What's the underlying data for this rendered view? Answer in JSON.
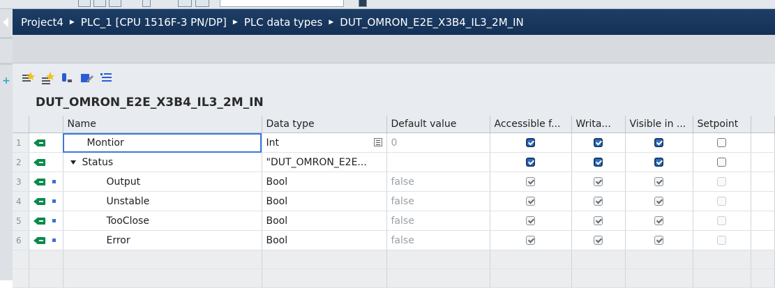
{
  "breadcrumb": [
    "Project4",
    "PLC_1 [CPU 1516F-3 PN/DP]",
    "PLC data types",
    "DUT_OMRON_E2E_X3B4_IL3_2M_IN"
  ],
  "block_title": "DUT_OMRON_E2E_X3B4_IL3_2M_IN",
  "toolbar_icons": [
    "insert-row-icon",
    "add-row-icon",
    "expand-icon",
    "edit-icon",
    "list-icon"
  ],
  "table": {
    "headers": [
      "Name",
      "Data type",
      "Default value",
      "Accessible f...",
      "Writa...",
      "Visible in ...",
      "Setpoint"
    ],
    "rows": [
      {
        "num": "1",
        "name": "Montior",
        "type": "Int",
        "default": "0",
        "accessible": "on",
        "writable": "on",
        "visible": "on",
        "setpoint": "off"
      },
      {
        "num": "2",
        "name": "Status",
        "type": "\"DUT_OMRON_E2E...",
        "default": "",
        "accessible": "on",
        "writable": "on",
        "visible": "on",
        "setpoint": "off"
      },
      {
        "num": "3",
        "name": "Output",
        "type": "Bool",
        "default": "false",
        "accessible": "gray",
        "writable": "gray",
        "visible": "gray",
        "setpoint": "dis"
      },
      {
        "num": "4",
        "name": "Unstable",
        "type": "Bool",
        "default": "false",
        "accessible": "gray",
        "writable": "gray",
        "visible": "gray",
        "setpoint": "dis"
      },
      {
        "num": "5",
        "name": "TooClose",
        "type": "Bool",
        "default": "false",
        "accessible": "gray",
        "writable": "gray",
        "visible": "gray",
        "setpoint": "dis"
      },
      {
        "num": "6",
        "name": "Error",
        "type": "Bool",
        "default": "false",
        "accessible": "gray",
        "writable": "gray",
        "visible": "gray",
        "setpoint": "dis"
      }
    ]
  },
  "colors": {
    "header_bar": "#1b3a60",
    "checkbox_on": "#2d6dc5",
    "interface_icon": "#0b8a4b",
    "element_dot": "#3d6fd8"
  }
}
